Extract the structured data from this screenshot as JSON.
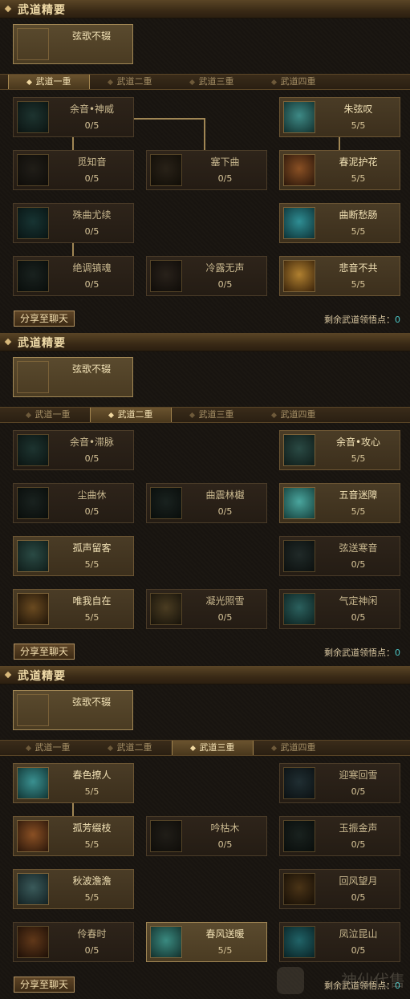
{
  "panels": [
    {
      "section_title": "武道精要",
      "essence": {
        "name": "弦歌不辍",
        "level": ""
      },
      "tabs": [
        "武道一重",
        "武道二重",
        "武道三重",
        "武道四重"
      ],
      "selected_tab": 0,
      "skills": [
        {
          "name": "余音•神威",
          "level": "0/5",
          "state": "locked",
          "icon": "sword-icon"
        },
        {
          "name": "觅知音",
          "level": "0/5",
          "state": "locked",
          "icon": "rune-icon"
        },
        {
          "name": "塞下曲",
          "level": "0/5",
          "state": "locked",
          "icon": "harp-icon"
        },
        {
          "name": "殊曲尤续",
          "level": "0/5",
          "state": "locked",
          "icon": "wave-icon"
        },
        {
          "name": "绝调镇魂",
          "level": "0/5",
          "state": "locked",
          "icon": "spirit-icon"
        },
        {
          "name": "冷露无声",
          "level": "0/5",
          "state": "locked",
          "icon": "mist-icon"
        },
        {
          "name": "朱弦叹",
          "level": "5/5",
          "state": "unlocked",
          "icon": "meditate-icon"
        },
        {
          "name": "春泥护花",
          "level": "5/5",
          "state": "unlocked",
          "icon": "flower-icon"
        },
        {
          "name": "曲断愁肠",
          "level": "5/5",
          "state": "unlocked",
          "icon": "vortex-icon"
        },
        {
          "name": "悲音不共",
          "level": "5/5",
          "state": "unlocked",
          "icon": "ring-icon"
        }
      ],
      "share_label": "分享至聊天",
      "remain_label": "剩余武道领悟点：",
      "remain_value": "0"
    },
    {
      "section_title": "武道精要",
      "essence": {
        "name": "弦歌不辍",
        "level": ""
      },
      "tabs": [
        "武道一重",
        "武道二重",
        "武道三重",
        "武道四重"
      ],
      "selected_tab": 1,
      "skills": [
        {
          "name": "余音•滞脉",
          "level": "0/5",
          "state": "locked",
          "icon": "sword-icon"
        },
        {
          "name": "尘曲休",
          "level": "0/5",
          "state": "locked",
          "icon": "spirit-icon"
        },
        {
          "name": "曲震林樾",
          "level": "0/5",
          "state": "locked",
          "icon": "spirit-icon"
        },
        {
          "name": "孤声留客",
          "level": "5/5",
          "state": "unlocked",
          "icon": "sword-icon"
        },
        {
          "name": "唯我自在",
          "level": "5/5",
          "state": "unlocked",
          "icon": "figure-icon"
        },
        {
          "name": "凝光照雪",
          "level": "0/5",
          "state": "locked",
          "icon": "light-icon"
        },
        {
          "name": "余音•攻心",
          "level": "5/5",
          "state": "unlocked",
          "icon": "sword-icon"
        },
        {
          "name": "五音迷障",
          "level": "5/5",
          "state": "unlocked",
          "icon": "swirl-icon"
        },
        {
          "name": "弦送寒音",
          "level": "0/5",
          "state": "locked",
          "icon": "cloud-icon"
        },
        {
          "name": "气定神闲",
          "level": "0/5",
          "state": "locked",
          "icon": "meditate-icon"
        }
      ],
      "share_label": "分享至聊天",
      "remain_label": "剩余武道领悟点：",
      "remain_value": "0"
    },
    {
      "section_title": "武道精要",
      "essence": {
        "name": "弦歌不辍",
        "level": ""
      },
      "tabs": [
        "武道一重",
        "武道二重",
        "武道三重",
        "武道四重"
      ],
      "selected_tab": 2,
      "skills": [
        {
          "name": "春色撩人",
          "level": "5/5",
          "state": "unlocked",
          "icon": "moon-icon"
        },
        {
          "name": "孤芳缀枝",
          "level": "5/5",
          "state": "unlocked",
          "icon": "flower-icon"
        },
        {
          "name": "吟枯木",
          "level": "0/5",
          "state": "locked",
          "icon": "rune-icon"
        },
        {
          "name": "秋波澹澹",
          "level": "5/5",
          "state": "unlocked",
          "icon": "blade-icon"
        },
        {
          "name": "伶春时",
          "level": "0/5",
          "state": "locked",
          "icon": "flower-icon"
        },
        {
          "name": "春风送暖",
          "level": "5/5",
          "state": "active",
          "icon": "wind-icon"
        },
        {
          "name": "迎寒回雪",
          "level": "0/5",
          "state": "locked",
          "icon": "snow-icon"
        },
        {
          "name": "玉振金声",
          "level": "0/5",
          "state": "locked",
          "icon": "spirit-icon"
        },
        {
          "name": "回风望月",
          "level": "0/5",
          "state": "locked",
          "icon": "figure-icon"
        },
        {
          "name": "凤泣昆山",
          "level": "0/5",
          "state": "locked",
          "icon": "vortex-icon"
        }
      ],
      "share_label": "分享至聊天",
      "remain_label": "剩余武道领悟点：",
      "remain_value": "0"
    }
  ],
  "colors": {
    "accent": "#a08654",
    "points": "#4cc9c9",
    "panel_bg": "#17130f"
  },
  "watermark": "神仙代售"
}
